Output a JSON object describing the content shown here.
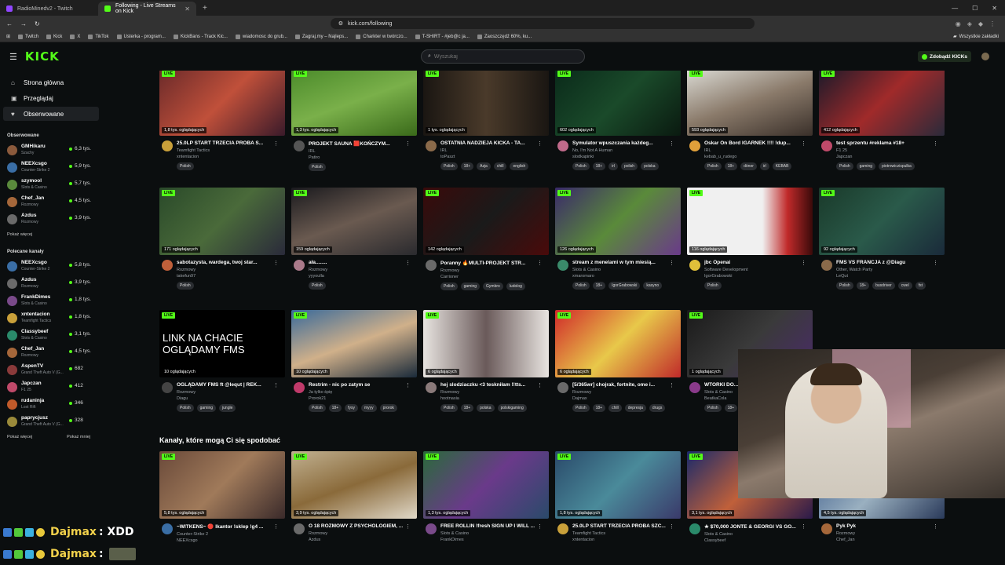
{
  "browser": {
    "tabs": [
      {
        "title": "RadioMinedv2 - Twitch",
        "color": "#9146ff",
        "active": false
      },
      {
        "title": "Following - Live Streams on Kick",
        "color": "#53fc18",
        "active": true
      }
    ],
    "url": "kick.com/following",
    "bookmarks": [
      "Twitch",
      "Kick",
      "X",
      "TikTok",
      "Usterka - program...",
      "KickBans - Track Kic...",
      "wiadomosc do grub...",
      "Zagraj.my – Najleps...",
      "Charkter w twórczo...",
      "T-SHIRT - #jeb@c ja...",
      "Zaoszczędź 60%, ku..."
    ],
    "bookmarks_all": "Wszystkie zakładki"
  },
  "header": {
    "logo": "KICK",
    "search_placeholder": "Wyszukaj",
    "kicks_button": "Zdobądź KICKs"
  },
  "sidebar": {
    "nav": [
      {
        "label": "Strona główna",
        "icon": "home-icon",
        "glyph": "⌂"
      },
      {
        "label": "Przeglądaj",
        "icon": "browse-icon",
        "glyph": "▣"
      },
      {
        "label": "Obserwowane",
        "icon": "heart-icon",
        "glyph": "♥"
      }
    ],
    "followed_title": "Obserwowane",
    "followed": [
      {
        "name": "GMHikaru",
        "cat": "Szachy",
        "viewers": "6,3 tys.",
        "color": "#8b5a3c"
      },
      {
        "name": "NEEXcsgo",
        "cat": "Counter-Strike 2",
        "viewers": "5,9 tys.",
        "color": "#3a6ea5"
      },
      {
        "name": "szymool",
        "cat": "Slots & Casino",
        "viewers": "5,7 tys.",
        "color": "#5a8a3c"
      },
      {
        "name": "Chef_Jan",
        "cat": "Rozmowy",
        "viewers": "4,5 tys.",
        "color": "#a5673a"
      },
      {
        "name": "Azdus",
        "cat": "Rozmowy",
        "viewers": "3,9 tys.",
        "color": "#6a6a6a"
      }
    ],
    "followed_more": "Pokaż więcej",
    "recommended_title": "Polecane kanały",
    "recommended": [
      {
        "name": "NEEXcsgo",
        "cat": "Counter-Strike 2",
        "viewers": "5,8 tys.",
        "color": "#3a6ea5"
      },
      {
        "name": "Azdus",
        "cat": "Rozmowy",
        "viewers": "3,9 tys.",
        "color": "#6a6a6a"
      },
      {
        "name": "FrankDimes",
        "cat": "Slots & Casino",
        "viewers": "1,8 tys.",
        "color": "#7a4a8a"
      },
      {
        "name": "xntentacion",
        "cat": "Teamfight Tactics",
        "viewers": "1,8 tys.",
        "color": "#c9a03a"
      },
      {
        "name": "Classybeef",
        "cat": "Slots & Casino",
        "viewers": "3,1 tys.",
        "color": "#2a8a6a"
      },
      {
        "name": "Chef_Jan",
        "cat": "Rozmowy",
        "viewers": "4,5 tys.",
        "color": "#a5673a"
      },
      {
        "name": "AspenTV",
        "cat": "Grand Theft Auto V (G...",
        "viewers": "682",
        "color": "#8a3a3a"
      },
      {
        "name": "Japczan",
        "cat": "F1 25",
        "viewers": "412",
        "color": "#c04a6a"
      },
      {
        "name": "rudaninja",
        "cat": "Lost Rift",
        "viewers": "346",
        "color": "#c05a2a"
      },
      {
        "name": "paprycjusz",
        "cat": "Grand Theft Auto V (G...",
        "viewers": "328",
        "color": "#9a8a3a"
      }
    ],
    "rec_more": "Pokaż więcej",
    "rec_less": "Pokaż mniej"
  },
  "live_label": "LIVE",
  "streams": [
    {
      "title": "25.0LP START TRZECIA PRÓBA S...",
      "cat": "Teamfight Tactics",
      "user": "xntentacion",
      "viewers": "1,8 tys. oglądających",
      "tags": [
        "Polish"
      ],
      "bg": "linear-gradient(135deg,#6a2a2a,#c0503a,#3a1a2a)",
      "av": "#c9a03a"
    },
    {
      "title": "PROJEKT SAUNA 🟥KOŃCZYM...",
      "cat": "IRL",
      "user": "Patiro",
      "viewers": "1,3 tys. oglądających",
      "tags": [
        "Polish"
      ],
      "bg": "linear-gradient(160deg,#4a8a2a,#7ab04a,#3a6a1a)",
      "av": "#555"
    },
    {
      "title": "OSTATNIA NADZIEJA KICKA - TA...",
      "cat": "IRL",
      "user": "toPaszt",
      "viewers": "1 tys. oglądających",
      "tags": [
        "Polish",
        "18+",
        "Azja",
        "chill",
        "english"
      ],
      "bg": "linear-gradient(90deg,#1a1612,#4a3a2a,#1a1612)",
      "av": "#8a6a4a"
    },
    {
      "title": "Symulator wpuszczania każdeg...",
      "cat": "No, I'm Not A Human",
      "user": "slodkapinki",
      "viewers": "602 oglądających",
      "tags": [
        "Polish",
        "18+",
        "irl",
        "polish",
        "polska"
      ],
      "bg": "linear-gradient(135deg,#0a2a1a,#1a4a2a,#0a1a10)",
      "av": "#c06a8a"
    },
    {
      "title": "Oskar On Bord IGARNEK !!!! !dup...",
      "cat": "IRL",
      "user": "kebab_u_rudego",
      "viewers": "593 oglądających",
      "tags": [
        "Polish",
        "18+",
        "döner",
        "irl",
        "KEBAB"
      ],
      "bg": "linear-gradient(160deg,#dcdcd6,#8a7a6a,#3a302a)",
      "av": "#e0a03a"
    },
    {
      "title": "test sprzentu #reklama #18+",
      "cat": "F1 25",
      "user": "Japczan",
      "viewers": "412 oglądających",
      "tags": [
        "Polish",
        "gaming",
        "piotrowiczispulka"
      ],
      "bg": "linear-gradient(135deg,#1a1a2a,#a02a2a,#2a2a3a)",
      "av": "#c04a6a"
    },
    {
      "title": "sabotazysta, wardega, twoj star...",
      "cat": "Rozmowy",
      "user": "takefun97",
      "viewers": "171 oglądających",
      "tags": [
        "Polish"
      ],
      "bg": "linear-gradient(135deg,#2a4a2a,#4a6a3a,#2a2a3a)",
      "av": "#c0603a"
    },
    {
      "title": "ała........",
      "cat": "Rozmowy",
      "user": "yyyoulla",
      "viewers": "159 oglądających",
      "tags": [
        "Polish"
      ],
      "bg": "linear-gradient(160deg,#1a1a1e,#6a5a50,#2a2a2e)",
      "av": "#aa7a8a"
    },
    {
      "title": "Poranny 🔥MULTI-PROJEKT STR...",
      "cat": "Rozmowy",
      "user": "Carrioner",
      "viewers": "142 oglądających",
      "tags": [
        "Polish",
        "gaming",
        "Gymbro",
        "ludolog"
      ],
      "bg": "linear-gradient(135deg,#3a0a0a,#1a1a1a,#4a0a0a)",
      "av": "#6a6a6a"
    },
    {
      "title": "stream z menelami w tym miesią...",
      "cat": "Slots & Casino",
      "user": "xmaromaro",
      "viewers": "126 oglądających",
      "tags": [
        "Polish",
        "18+",
        "IgorGrabowski",
        "kasyno"
      ],
      "bg": "linear-gradient(135deg,#3a2a6a,#5a8a3a,#6a3a8a)",
      "av": "#3a8a6a"
    },
    {
      "title": "jbc Openai",
      "cat": "Software Development",
      "user": "IgorGrabowski",
      "viewers": "116 oglądających",
      "tags": [
        "Polish"
      ],
      "bg": "linear-gradient(90deg,#f0f0f0 0%,#f0f0f0 60%,#c02a2a 80%,#3a0a0a 100%)",
      "av": "#e0c03a"
    },
    {
      "title": "FMS VS FRANCJA z @Diagu",
      "cat": "Other, Watch Party",
      "user": "LeQut",
      "viewers": "92 oglądających",
      "tags": [
        "Polish",
        "18+",
        "busdriver",
        "cwel",
        "fst"
      ],
      "bg": "linear-gradient(135deg,#1a3a2a,#2a5a4a,#1a2a3a)",
      "av": "#8a6a4a"
    },
    {
      "title": "OGLĄDAMY FMS ft @lequt | REK...",
      "cat": "Rozmowy",
      "user": "Diagu",
      "viewers": "10 oglądających",
      "tags": [
        "Polish",
        "gaming",
        "jungle"
      ],
      "bg": "#000000",
      "av": "#444",
      "overlay": "LINK NA CHACIE OGLĄDAMY FMS"
    },
    {
      "title": "Restrim - nic po zatym se",
      "cat": "Ja tylko śpię",
      "user": "Prorok21",
      "viewers": "10 oglądających",
      "tags": [
        "Polish",
        "18+",
        "fysy",
        "myyy",
        "prorok"
      ],
      "bg": "linear-gradient(160deg,#3a6a9a,#d0b08a,#1a2a3a)",
      "av": "#c03a6a"
    },
    {
      "title": "hej slodziaczku <3 teskniłam !!tts...",
      "cat": "Rozmowy",
      "user": "hootnasia",
      "viewers": "6 oglądających",
      "tags": [
        "Polish",
        "18+",
        "polska",
        "polskigaming"
      ],
      "bg": "linear-gradient(90deg,#e8e4e0,#6a5a5a,#e8e4e0)",
      "av": "#8a7a7a"
    },
    {
      "title": "[5/365wr] chojrak, fortnite, ome i...",
      "cat": "Rozmowy",
      "user": "Dajmax",
      "viewers": "6 oglądających",
      "tags": [
        "Polish",
        "18+",
        "chill",
        "depresja",
        "drugs"
      ],
      "bg": "linear-gradient(135deg,#d02a2a,#e8c84a,#c02a2a)",
      "av": "#6a6a6a"
    },
    {
      "title": "WTORKI DO...",
      "cat": "Slots & Casino",
      "user": "BeatkaCola",
      "viewers": "1 oglądających",
      "tags": [
        "Polish",
        "18+"
      ],
      "bg": "linear-gradient(135deg,#1a1a1a,#3a3a3a,#4a2a6a)",
      "av": "#8a3a8a"
    }
  ],
  "recommended_section_title": "Kanały, które mogą Ci się spodobać",
  "rec_streams": [
    {
      "title": "~WITKENS~ 🔴 Ikantor !sklep !g4 ...",
      "cat": "Counter-Strike 2",
      "user": "NEEXcsgo",
      "viewers": "5,8 tys. oglądających",
      "bg": "linear-gradient(135deg,#6a4a3a,#a07a5a,#3a2a2a)",
      "av": "#3a6ea5"
    },
    {
      "title": "O 18 ROZMOWY Z PSYCHOLOGIEM, ...",
      "cat": "Rozmowy",
      "user": "Azdus",
      "viewers": "3,9 tys. oglądających",
      "bg": "linear-gradient(160deg,#c0b090,#8a6a3a,#e0d8c8)",
      "av": "#6a6a6a"
    },
    {
      "title": "FREE ROLLIN !fresh SIGN UP I WILL ...",
      "cat": "Slots & Casino",
      "user": "FrankDimes",
      "viewers": "1,3 tys. oglądających",
      "bg": "linear-gradient(135deg,#2a6a3a,#6a3a8a,#2a4a6a)",
      "av": "#7a4a8a"
    },
    {
      "title": "25.0LP START TRZECIA PRÓBA SZC...",
      "cat": "Teamfight Tactics",
      "user": "xntentacion",
      "viewers": "1,8 tys. oglądających",
      "bg": "linear-gradient(135deg,#2a4a6a,#4a8a9a,#3a3a6a)",
      "av": "#c9a03a"
    },
    {
      "title": "★ $70,000 JONTE & GEORGI VS GO...",
      "cat": "Slots & Casino",
      "user": "Classybeef",
      "viewers": "3,1 tys. oglądających",
      "bg": "linear-gradient(135deg,#1a2a6a,#c0603a,#2a1a4a)",
      "av": "#2a8a6a"
    },
    {
      "title": "Pyk Pyk",
      "cat": "Rozmowy",
      "user": "Chef_Jan",
      "viewers": "4,5 tys. oglądających",
      "bg": "linear-gradient(135deg,#3a5a8a,#9ab0c0,#2a3a5a)",
      "av": "#a5673a"
    }
  ],
  "chat": [
    {
      "name": "Dajmax",
      "message": ": XDD"
    },
    {
      "name": "Dajmax",
      "message": ":"
    }
  ]
}
